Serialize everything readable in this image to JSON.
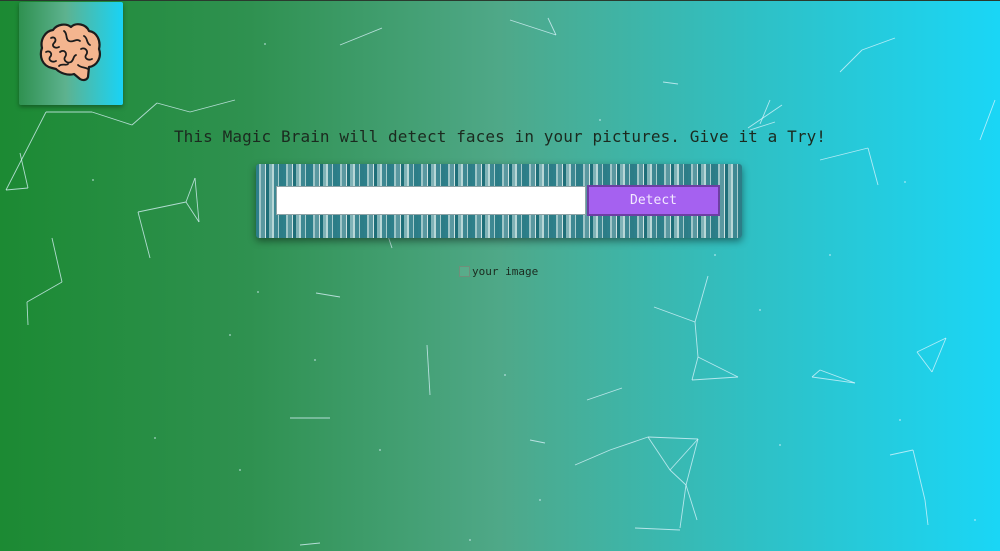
{
  "header": {
    "logo_icon": "brain-icon"
  },
  "main": {
    "tagline": "This Magic Brain will detect faces in your pictures. Give it a Try!",
    "input": {
      "value": "",
      "placeholder": ""
    },
    "detect_button_label": "Detect",
    "result_image_alt": "your image",
    "result_image_icon": "broken-image-icon"
  },
  "colors": {
    "gradient_start": "#1c8a33",
    "gradient_end": "#1ad6f6",
    "button": "#a561f0",
    "particle_lines": "#dff6ff"
  }
}
